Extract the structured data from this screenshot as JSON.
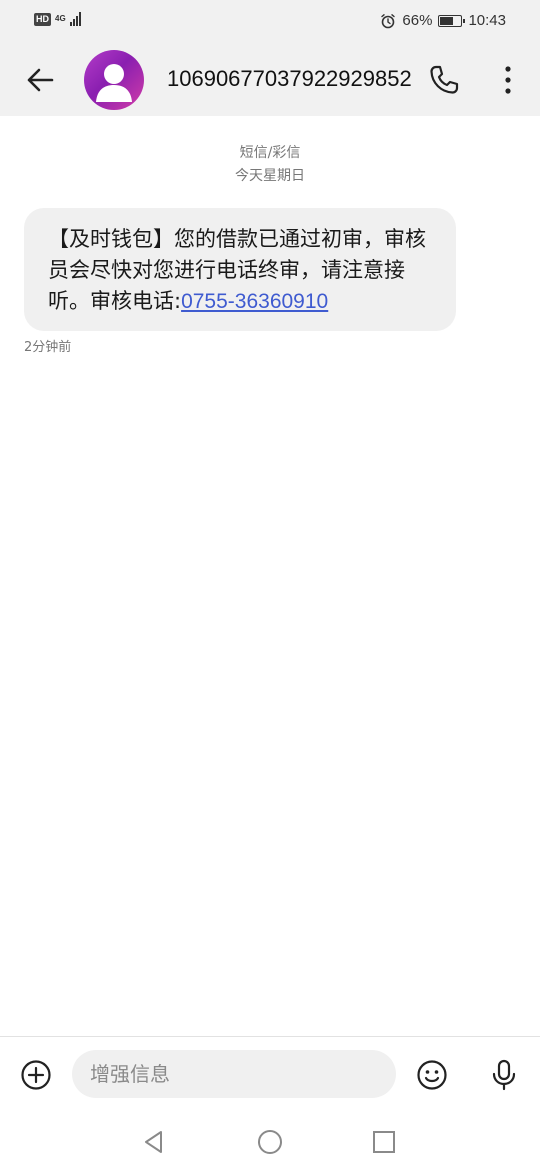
{
  "status_bar": {
    "hd_label": "HD",
    "network_label": "4G",
    "battery_text": "66%",
    "battery_level": 0.66,
    "time": "10:43"
  },
  "header": {
    "contact_number": "10690677037922929852"
  },
  "conversation": {
    "type_label": "短信/彩信",
    "date_label": "今天星期日",
    "messages": [
      {
        "text": "【及时钱包】您的借款已通过初审，审核员会尽快对您进行电话终审，请注意接听。审核电话:",
        "phone": "0755-36360910",
        "time": "2分钟前"
      }
    ]
  },
  "composer": {
    "placeholder": "增强信息"
  },
  "colors": {
    "bar_background": "#f1f1f1",
    "bubble_background": "#f0f0f0",
    "link": "#3f5bd0",
    "avatar_gradient": [
      "#b43cc9",
      "#8a1fb0",
      "#d23ca8"
    ]
  },
  "icons": {
    "back": "arrow-left-icon",
    "call": "phone-icon",
    "more": "more-vertical-icon",
    "add": "plus-circle-icon",
    "emoji": "emoji-icon",
    "mic": "microphone-icon",
    "nav_back": "triangle-back-icon",
    "nav_home": "circle-home-icon",
    "nav_recents": "square-recents-icon"
  }
}
